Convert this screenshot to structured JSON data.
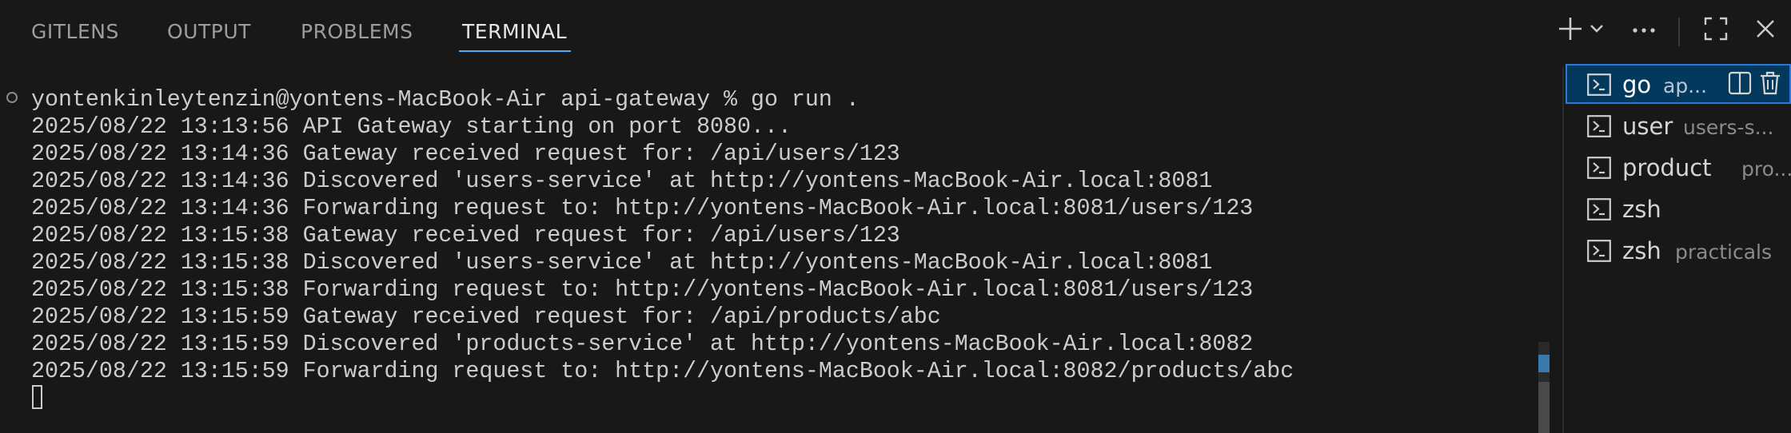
{
  "tabs": [
    {
      "label": "GITLENS",
      "active": false
    },
    {
      "label": "OUTPUT",
      "active": false
    },
    {
      "label": "PROBLEMS",
      "active": false
    },
    {
      "label": "TERMINAL",
      "active": true
    }
  ],
  "toolbar": {
    "icons": [
      "add-icon",
      "chevron-down-icon",
      "ellipsis-icon",
      "maximize-icon",
      "close-icon"
    ]
  },
  "terminal": {
    "lines": [
      "yontenkinleytenzin@yontens-MacBook-Air api-gateway % go run .",
      "2025/08/22 13:13:56 API Gateway starting on port 8080...",
      "2025/08/22 13:14:36 Gateway received request for: /api/users/123",
      "2025/08/22 13:14:36 Discovered 'users-service' at http://yontens-MacBook-Air.local:8081",
      "2025/08/22 13:14:36 Forwarding request to: http://yontens-MacBook-Air.local:8081/users/123",
      "2025/08/22 13:15:38 Gateway received request for: /api/users/123",
      "2025/08/22 13:15:38 Discovered 'users-service' at http://yontens-MacBook-Air.local:8081",
      "2025/08/22 13:15:38 Forwarding request to: http://yontens-MacBook-Air.local:8081/users/123",
      "2025/08/22 13:15:59 Gateway received request for: /api/products/abc",
      "2025/08/22 13:15:59 Discovered 'products-service' at http://yontens-MacBook-Air.local:8082",
      "2025/08/22 13:15:59 Forwarding request to: http://yontens-MacBook-Air.local:8082/products/abc"
    ]
  },
  "terminal_list": [
    {
      "name": "go",
      "desc": "ap...",
      "selected": true
    },
    {
      "name": "user",
      "desc": "users-s...",
      "selected": false
    },
    {
      "name": "product",
      "desc": "pro...",
      "selected": false
    },
    {
      "name": "zsh",
      "desc": "",
      "selected": false
    },
    {
      "name": "zsh",
      "desc": "practicals",
      "selected": false
    }
  ],
  "colors": {
    "background": "#181818",
    "accent": "#4daafc",
    "selected_item": "#04395e",
    "text": "#cccccc"
  }
}
